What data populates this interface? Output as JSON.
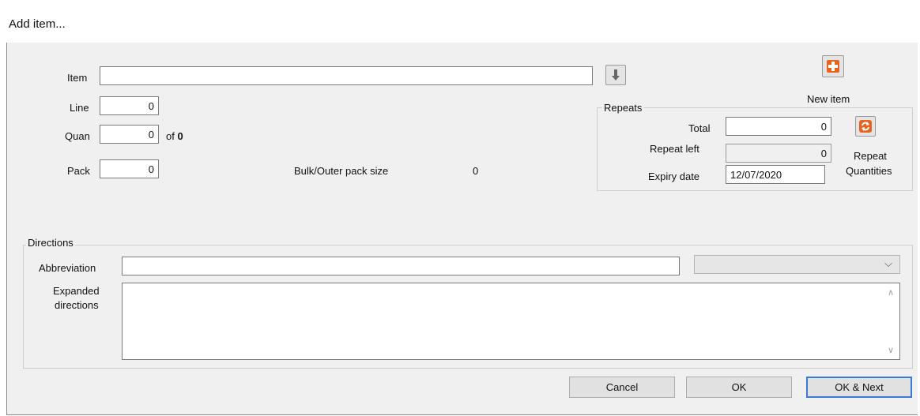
{
  "window": {
    "title": "Add item..."
  },
  "item": {
    "label": "Item",
    "value": ""
  },
  "line": {
    "label": "Line",
    "value": "0"
  },
  "quan": {
    "label": "Quan",
    "value": "0",
    "of_prefix": "of",
    "of_value": "0"
  },
  "pack": {
    "label": "Pack",
    "value": "0"
  },
  "bulk": {
    "label": "Bulk/Outer pack size",
    "value": "0"
  },
  "new_item": {
    "label": "New item"
  },
  "repeats": {
    "title": "Repeats",
    "total_label": "Total",
    "total_value": "0",
    "left_label": "Repeat left",
    "left_value": "0",
    "expiry_label": "Expiry date",
    "expiry_value": "12/07/2020",
    "button_label_1": "Repeat",
    "button_label_2": "Quantities"
  },
  "directions": {
    "title": "Directions",
    "abbrev_label": "Abbreviation",
    "abbrev_value": "",
    "dropdown_value": "",
    "expanded_label_1": "Expanded",
    "expanded_label_2": "directions",
    "expanded_value": ""
  },
  "buttons": {
    "cancel": "Cancel",
    "ok": "OK",
    "ok_next": "OK & Next"
  },
  "colors": {
    "accent": "#3a7bd5",
    "plus_icon": "#e8641e",
    "dialog_bg": "#f0f0f0"
  }
}
